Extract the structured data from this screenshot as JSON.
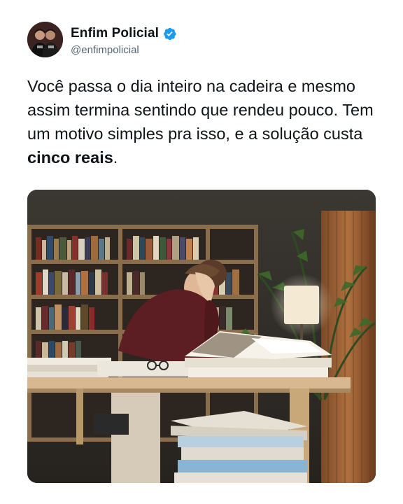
{
  "account": {
    "display_name": "Enfim Policial",
    "handle": "@enfimpolicial",
    "verified": true,
    "avatar_icon": "avatar-two-men",
    "verified_icon": "verified-badge-icon",
    "verified_color": "#1d9bf0"
  },
  "tweet": {
    "text_before": "Você passa o dia inteiro na cadeira e mesmo assim termina sentindo que rendeu pouco. Tem um motivo simples pra isso, e a solução custa ",
    "text_bold": "cinco reais",
    "text_after": "."
  },
  "media": {
    "icon": "photo-woman-tired-at-library-desk"
  }
}
